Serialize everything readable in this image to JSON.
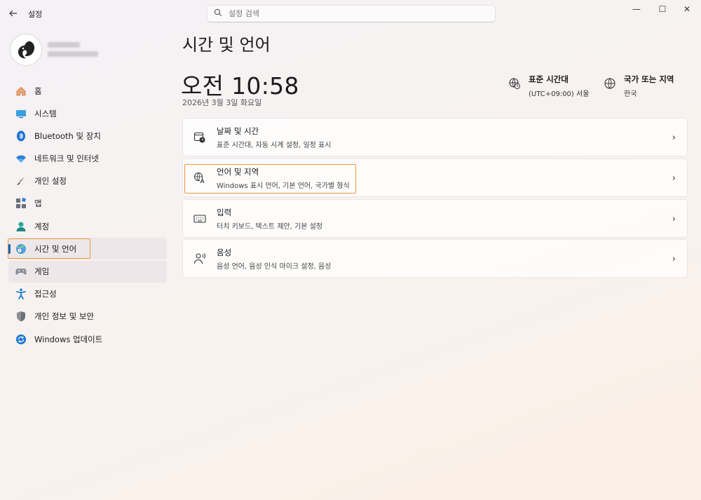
{
  "window": {
    "title": "설정",
    "controls": {
      "minimize": "—",
      "maximize": "☐",
      "close": "✕"
    }
  },
  "search": {
    "placeholder": "설정 검색",
    "value": ""
  },
  "sidebar": {
    "items": [
      {
        "label": "홈",
        "icon": "home-icon"
      },
      {
        "label": "시스템",
        "icon": "system-icon"
      },
      {
        "label": "Bluetooth 및 장치",
        "icon": "bluetooth-icon"
      },
      {
        "label": "네트워크 및 인터넷",
        "icon": "wifi-icon"
      },
      {
        "label": "개인 설정",
        "icon": "brush-icon"
      },
      {
        "label": "앱",
        "icon": "apps-icon"
      },
      {
        "label": "계정",
        "icon": "account-icon"
      },
      {
        "label": "시간 및 언어",
        "icon": "globe-clock-icon",
        "active": true
      },
      {
        "label": "게임",
        "icon": "gamepad-icon"
      },
      {
        "label": "접근성",
        "icon": "accessibility-icon"
      },
      {
        "label": "개인 정보 및 보안",
        "icon": "shield-icon"
      },
      {
        "label": "Windows 업데이트",
        "icon": "update-icon"
      }
    ]
  },
  "main": {
    "title": "시간 및 언어",
    "clock": "오전 10:58",
    "date": "2026년 3월 3일 화요일",
    "timezone": {
      "title": "표준 시간대",
      "value": "(UTC+09:00) 서울"
    },
    "region": {
      "title": "국가 또는 지역",
      "value": "한국"
    },
    "cards": [
      {
        "title": "날짜 및 시간",
        "subtitle": "표준 시간대, 자동 시계 설정, 일정 표시",
        "icon": "calendar-clock-icon"
      },
      {
        "title": "언어 및 지역",
        "subtitle": "Windows 표시 언어, 기본 언어, 국가별 형식",
        "icon": "language-icon"
      },
      {
        "title": "입력",
        "subtitle": "터치 키보드, 텍스트 제안, 기본 설정",
        "icon": "keyboard-icon"
      },
      {
        "title": "음성",
        "subtitle": "음성 언어, 음성 인식 마이크 설정, 음성",
        "icon": "speech-icon"
      }
    ]
  },
  "colors": {
    "accent": "#0067c0",
    "highlight": "#f0953a"
  }
}
